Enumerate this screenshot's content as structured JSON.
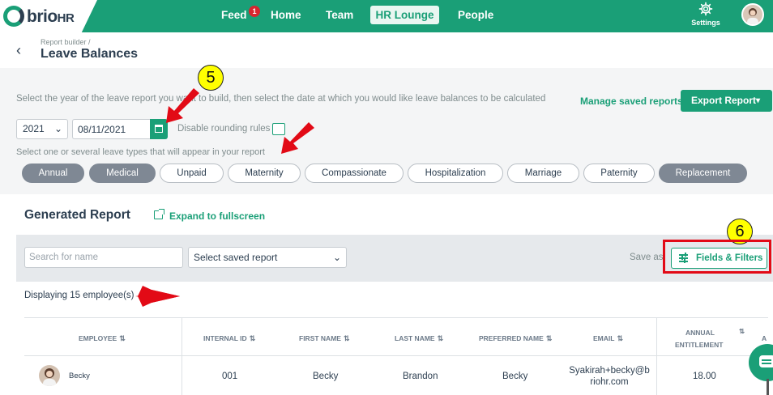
{
  "brand": {
    "name": "brio",
    "suffix": "HR"
  },
  "nav": {
    "items": [
      {
        "label": "Feed"
      },
      {
        "label": "Home"
      },
      {
        "label": "Team"
      },
      {
        "label": "HR Lounge"
      },
      {
        "label": "People"
      }
    ],
    "feed_badge": "1",
    "settings_label": "Settings"
  },
  "header": {
    "breadcrumb": "Report builder /",
    "title": "Leave Balances"
  },
  "filters": {
    "instruction_year": "Select the year of the leave report you want to build, then select the date at which you would like leave balances to be calculated",
    "manage_link": "Manage saved reports",
    "export_label": "Export Report",
    "year_value": "2021",
    "date_value": "08/11/2021",
    "rounding_label": "Disable rounding rules",
    "rounding_checked": false,
    "instruction_types": "Select one or several leave types that will appear in your report",
    "leave_types": [
      {
        "label": "Annual",
        "selected": true
      },
      {
        "label": "Medical",
        "selected": true
      },
      {
        "label": "Unpaid",
        "selected": false
      },
      {
        "label": "Maternity",
        "selected": false
      },
      {
        "label": "Compassionate",
        "selected": false
      },
      {
        "label": "Hospitalization",
        "selected": false
      },
      {
        "label": "Marriage",
        "selected": false
      },
      {
        "label": "Paternity",
        "selected": false
      },
      {
        "label": "Replacement",
        "selected": true
      }
    ]
  },
  "report": {
    "title": "Generated Report",
    "expand_label": "Expand to fullscreen",
    "search_placeholder": "Search for name",
    "saved_report_placeholder": "Select saved report",
    "save_as_label": "Save as",
    "fields_filters_label": "Fields & Filters",
    "displaying_text": "Displaying 15 employee(s)"
  },
  "table": {
    "columns": [
      "EMPLOYEE",
      "INTERNAL ID",
      "FIRST NAME",
      "LAST NAME",
      "PREFERRED NAME",
      "EMAIL",
      "ANNUAL",
      "ENTITLEMENT",
      "A"
    ],
    "sort_glyph": "⇅",
    "rows": [
      {
        "employee": "Becky",
        "internal_id": "001",
        "first_name": "Becky",
        "last_name": "Brandon",
        "preferred_name": "Becky",
        "email_line1": "Syakirah+becky@b",
        "email_line2": "riohr.com",
        "annual_entitlement": "18.00"
      }
    ]
  },
  "annotations": {
    "callout_5": "5",
    "callout_6": "6"
  },
  "colors": {
    "brand_green": "#1a9f77",
    "selected_chip": "#7f8894",
    "annotation_red": "#e20a16",
    "callout_yellow": "#ffff00"
  }
}
